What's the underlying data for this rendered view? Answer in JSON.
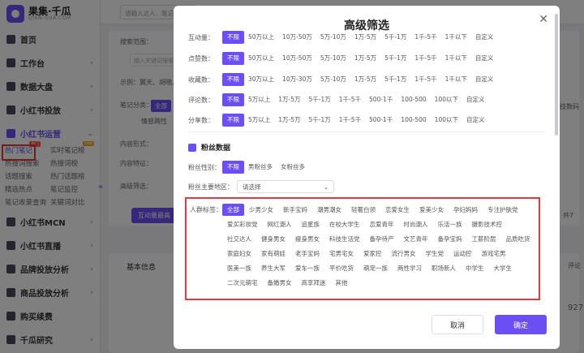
{
  "app": {
    "name": "果集·千瓜",
    "domain": "QIAN-GUA.COM"
  },
  "search": {
    "placeholder": "请输入达人、笔记"
  },
  "sidebar": {
    "items": [
      {
        "label": "首页",
        "icon": "home-icon"
      },
      {
        "label": "工作台",
        "icon": "workbench-icon"
      },
      {
        "label": "数据大盘",
        "icon": "dashboard-icon"
      },
      {
        "label": "小红书投放",
        "icon": "ads-icon"
      },
      {
        "label": "小红书运营",
        "icon": "operation-icon"
      }
    ],
    "sub_items": [
      "热门笔记",
      "实时笔记榜",
      "热搜词搜索",
      "热搜词榜",
      "话题搜索",
      "热门话题榜",
      "精选热点",
      "笔记监控",
      "笔记收录查询",
      "关键词对比"
    ],
    "sub_badges": {
      "hot": "热门",
      "new": "new"
    },
    "items_bottom": [
      {
        "label": "小红书MCN",
        "icon": "mcn-icon"
      },
      {
        "label": "小红书直播",
        "icon": "live-icon"
      },
      {
        "label": "品牌投放分析",
        "icon": "brand-icon"
      },
      {
        "label": "商品投放分析",
        "icon": "goods-icon"
      },
      {
        "label": "购买续费",
        "icon": "cart-icon"
      },
      {
        "label": "千瓜研究",
        "icon": "research-icon"
      }
    ]
  },
  "background": {
    "search_scope_label": "搜索范围：",
    "search_input_placeholder": "输入关键词搜索",
    "example_text": "示例：翼天、胡晓、减肥",
    "note_category_label": "笔记分类：",
    "note_category_all": "全部",
    "note_category_sub": "情感两性",
    "content_form_label": "内容形式：",
    "content_feature_label": "内容特征：",
    "advanced_label": "高级筛选：",
    "interaction_button": "互动量最高",
    "basic_info": "基本信息",
    "right_tag": "科技数码",
    "right_count": "共7",
    "right_text": "评论",
    "right_num": "927"
  },
  "modal": {
    "title": "高级筛选",
    "filters": [
      {
        "label": "互动量：",
        "options": [
          "不限",
          "50万以上",
          "10万-50万",
          "5万-10万",
          "1万-5万",
          "5千-1万",
          "1千-5千",
          "1千以下",
          "自定义"
        ],
        "selected": 0
      },
      {
        "label": "点赞数：",
        "options": [
          "不限",
          "50万以上",
          "10万-50万",
          "5万-10万",
          "1万-5万",
          "5千-1万",
          "1千-5千",
          "1千以下",
          "自定义"
        ],
        "selected": 0
      },
      {
        "label": "收藏数：",
        "options": [
          "不限",
          "30万以上",
          "10万-30万",
          "5万-10万",
          "1万-5万",
          "5千-1万",
          "1千-5千",
          "1千以下",
          "自定义"
        ],
        "selected": 0
      },
      {
        "label": "评论数：",
        "options": [
          "不限",
          "5万以上",
          "1万-5万",
          "5千-1万",
          "1千-5千",
          "500-1千",
          "100-500",
          "100以下",
          "自定义"
        ],
        "selected": 0
      },
      {
        "label": "分享数：",
        "options": [
          "不限",
          "5万以上",
          "1万-5万",
          "5千-1万",
          "1千-5千",
          "500-1千",
          "100-500",
          "100以下",
          "自定义"
        ],
        "selected": 0
      }
    ],
    "fans_section_title": "粉丝数据",
    "gender": {
      "label": "粉丝性别：",
      "options": [
        "不限",
        "男粉丝多",
        "女粉丝多"
      ],
      "selected": 0
    },
    "region": {
      "label": "粉丝主要地区：",
      "placeholder": "请选择"
    },
    "crowd": {
      "label": "人群标签：",
      "tags": [
        "全部",
        "少男少女",
        "新手宝妈",
        "潮男潮女",
        "轻奢白领",
        "恋爱女生",
        "爱美少女",
        "孕妇妈妈",
        "专注护肤党",
        "爱买彩妆党",
        "网红潮人",
        "追星族",
        "在校大学生",
        "恋爱青年",
        "时尚潮人",
        "乐活一族",
        "摄影技术控",
        "社交达人",
        "健身男女",
        "瘦身男女",
        "科技生活党",
        "备孕待产",
        "文艺青年",
        "备孕宝妈",
        "工薪阶层",
        "品质吃货",
        "家庭妇女",
        "家有萌娃",
        "老手宝妈",
        "宅男宅女",
        "爱家控",
        "流行男女",
        "学生党",
        "运动控",
        "游戏宅男",
        "医美一族",
        "养生大军",
        "爱车一族",
        "平价吃货",
        "萌宠一族",
        "两性学习",
        "职场新人",
        "中学生",
        "大学生",
        "二次元萌宅",
        "备婚男女",
        "高享拜迷",
        "其他"
      ],
      "selected": 0
    },
    "cancel": "取消",
    "confirm": "确定"
  },
  "colors": {
    "accent": "#6c4ef5",
    "highlight": "#e4393c"
  }
}
